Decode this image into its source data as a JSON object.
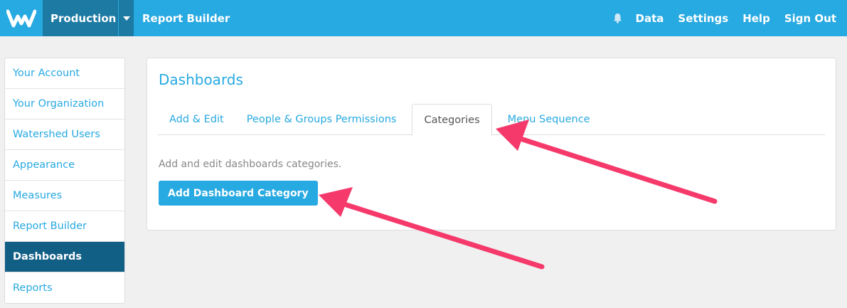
{
  "header": {
    "environment": "Production",
    "title": "Report Builder",
    "nav": [
      "Data",
      "Settings",
      "Help",
      "Sign Out"
    ],
    "brand_color": "#27a9e1",
    "dark_color": "#1c7aa3"
  },
  "sidebar": {
    "items": [
      {
        "label": "Your Account"
      },
      {
        "label": "Your Organization"
      },
      {
        "label": "Watershed Users"
      },
      {
        "label": "Appearance"
      },
      {
        "label": "Measures"
      },
      {
        "label": "Report Builder"
      },
      {
        "label": "Dashboards",
        "active": true
      },
      {
        "label": "Reports"
      }
    ],
    "active_color": "#125f86"
  },
  "main": {
    "title": "Dashboards",
    "tabs": [
      {
        "label": "Add & Edit"
      },
      {
        "label": "People & Groups Permissions"
      },
      {
        "label": "Categories",
        "active": true
      },
      {
        "label": "Menu Sequence"
      }
    ],
    "description": "Add and edit dashboards categories.",
    "add_button_label": "Add Dashboard Category"
  },
  "annotations": {
    "arrow_color": "#f5396b"
  }
}
